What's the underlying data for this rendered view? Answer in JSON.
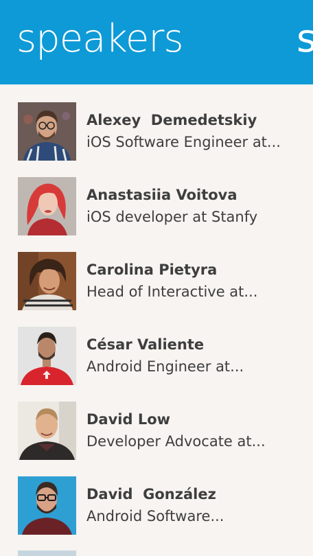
{
  "header": {
    "title": "speakers",
    "next_pivot_peek": "s"
  },
  "speakers": [
    {
      "name": "Alexey  Demedetskiy",
      "subtitle": "iOS Software Engineer at...",
      "avatar_colors": {
        "bg": "#6b5a55",
        "skin": "#d2a384",
        "hair": "#4b3426",
        "shirt": "#2d4a78"
      }
    },
    {
      "name": "Anastasiia Voitova",
      "subtitle": "iOS developer at Stanfy",
      "avatar_colors": {
        "bg": "#bfb7b2",
        "skin": "#efc9b6",
        "hair": "#d73a38",
        "shirt": "#b42d32"
      }
    },
    {
      "name": "Carolina Pietyra",
      "subtitle": "Head of Interactive at...",
      "avatar_colors": {
        "bg": "#8a5330",
        "skin": "#d59c78",
        "hair": "#3a2418",
        "shirt": "#e6e1da"
      }
    },
    {
      "name": "César Valiente",
      "subtitle": "Android Engineer at...",
      "avatar_colors": {
        "bg": "#e3e3e3",
        "skin": "#b9876a",
        "hair": "#2b2019",
        "shirt": "#d8242c"
      }
    },
    {
      "name": "David Low",
      "subtitle": "Developer Advocate at...",
      "avatar_colors": {
        "bg": "#ece9e3",
        "skin": "#e2b28e",
        "hair": "#b58a5c",
        "shirt": "#2f2a2a"
      }
    },
    {
      "name": "David  González",
      "subtitle": "Android Software...",
      "avatar_colors": {
        "bg": "#2e9fd2",
        "skin": "#d8a286",
        "hair": "#3a2a22",
        "shirt": "#6a2226"
      }
    }
  ]
}
